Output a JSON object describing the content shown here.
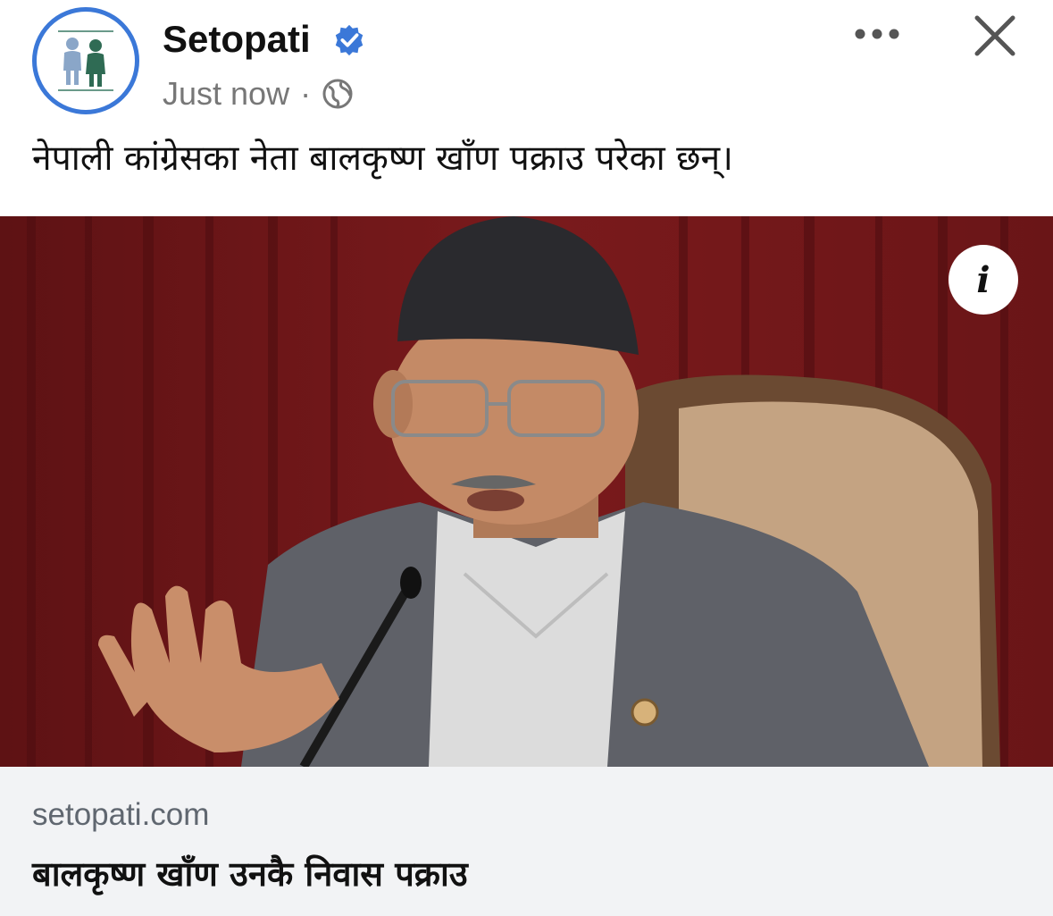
{
  "post": {
    "page_name": "Setopati",
    "timestamp": "Just now",
    "separator": "·",
    "caption": "नेपाली कांग्रेसका नेता बालकृष्ण खाँण पक्राउ परेका छन्।",
    "icons": {
      "verified": "verified-badge-icon",
      "audience": "globe-icon",
      "more": "more-options-icon",
      "close": "close-icon",
      "info": "info-icon"
    }
  },
  "link_preview": {
    "domain": "setopati.com",
    "headline": "बालकृष्ण खाँण उनकै निवास पक्राउ"
  },
  "colors": {
    "verified_blue": "#3b78d8",
    "link_card_bg": "#f2f3f5",
    "curtain_red": "#7a1a1c"
  }
}
